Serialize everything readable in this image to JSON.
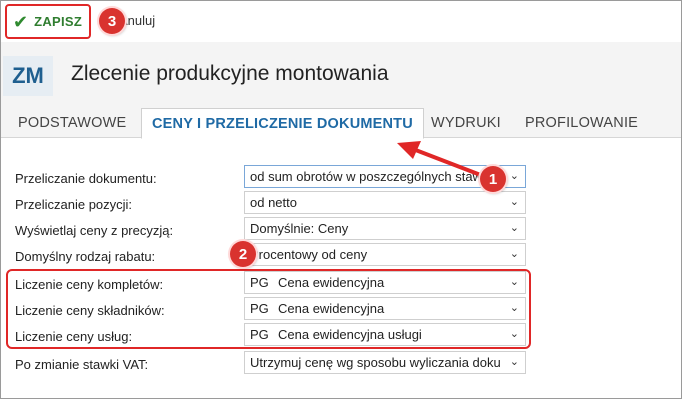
{
  "toolbar": {
    "save_label": "ZAPISZ",
    "cancel_label": "Anuluj"
  },
  "header": {
    "doc_type": "ZM",
    "title": "Zlecenie produkcyjne montowania"
  },
  "tabs": [
    {
      "label": "PODSTAWOWE"
    },
    {
      "label": "CENY I PRZELICZENIE DOKUMENTU"
    },
    {
      "label": "WYDRUKI"
    },
    {
      "label": "PROFILOWANIE"
    }
  ],
  "form": {
    "rows": [
      {
        "label": "Przeliczanie dokumentu:",
        "value": "od sum obrotów w poszczególnych stawkach"
      },
      {
        "label": "Przeliczanie pozycji:",
        "value": "od netto"
      },
      {
        "label": "Wyświetlaj ceny z precyzją:",
        "value": "Domyślnie: Ceny"
      },
      {
        "label": "Domyślny rodzaj rabatu:",
        "value": "Procentowy od ceny"
      },
      {
        "label": "Liczenie ceny kompletów:",
        "code": "PG",
        "value": "Cena ewidencyjna"
      },
      {
        "label": "Liczenie ceny składników:",
        "code": "PG",
        "value": "Cena ewidencyjna"
      },
      {
        "label": "Liczenie ceny usług:",
        "code": "PG",
        "value": "Cena ewidencyjna usługi"
      },
      {
        "label": "Po zmianie stawki VAT:",
        "value": "Utrzymuj cenę wg sposobu wyliczania dokumentu"
      }
    ]
  },
  "annotations": {
    "badge_1": "1",
    "badge_2": "2",
    "badge_3": "3"
  },
  "colors": {
    "highlight": "#e02727",
    "badge": "#d9332f",
    "active_tab": "#1f6aa5",
    "save_green": "#2f7d2f"
  }
}
